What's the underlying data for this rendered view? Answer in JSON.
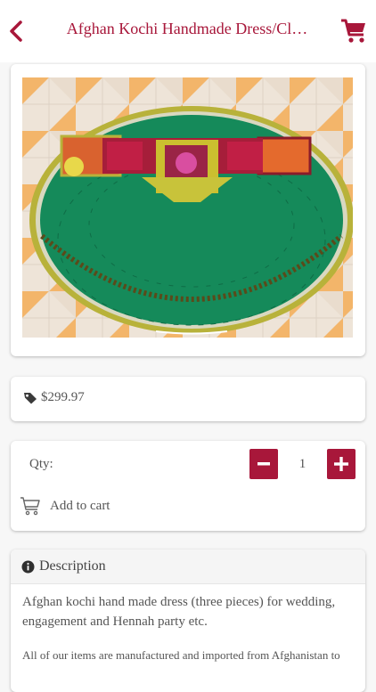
{
  "header": {
    "title": "Afghan Kochi Handmade Dress/Cl…",
    "back_icon": "chevron-left-icon",
    "cart_icon": "shopping-cart-icon",
    "accent": "#a8173a"
  },
  "product": {
    "image_desc_icon": "product-photo"
  },
  "price": {
    "icon": "tag-icon",
    "value": "$299.97"
  },
  "quantity": {
    "label": "Qty:",
    "value": "1",
    "minus_icon": "minus-icon",
    "plus_icon": "plus-icon"
  },
  "add_to_cart": {
    "label": "Add to cart",
    "icon": "cart-outline-icon"
  },
  "description": {
    "title": "Description",
    "icon": "info-icon",
    "text": "Afghan kochi hand made dress (three pieces) for wedding, engagement and Hennah party etc.",
    "text2": "All of our items are manufactured and imported from Afghanistan to"
  }
}
